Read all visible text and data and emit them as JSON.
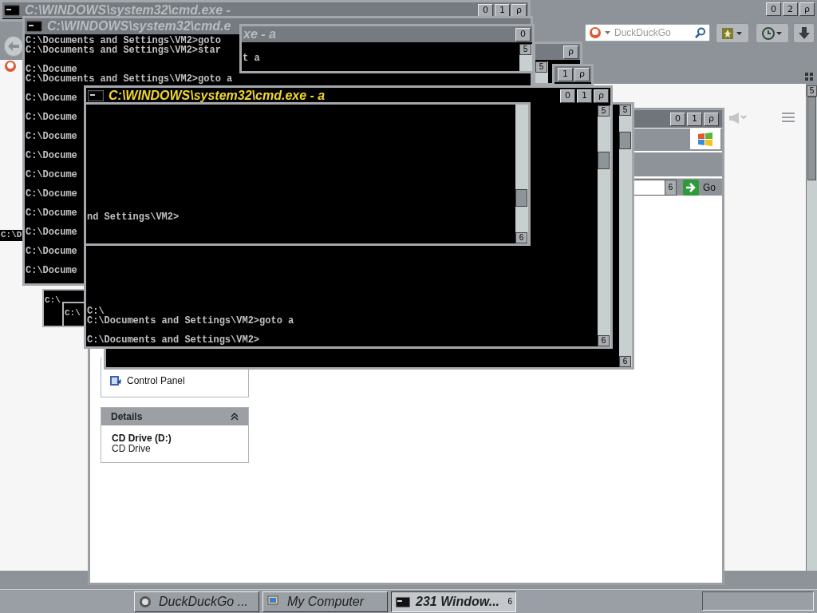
{
  "browser": {
    "title_buttons": [
      "0",
      "2",
      "ρ"
    ],
    "search": {
      "placeholder": "DuckDuckGo"
    },
    "scroll_button": "5"
  },
  "explorer": {
    "title_buttons": [
      "0",
      "1",
      "ρ"
    ],
    "address_button": "6",
    "go_label": "Go",
    "tasks": [
      {
        "label": "Control Panel"
      }
    ],
    "details": {
      "title": "Details",
      "name": "CD Drive (D:)",
      "type": "CD Drive"
    }
  },
  "consoles": [
    {
      "title": "C:\\WINDOWS\\system32\\cmd.exe -",
      "active": false,
      "buttons": [
        "0",
        "1",
        "ρ"
      ]
    },
    {
      "title": "C:\\WINDOWS\\system32\\cmd.e",
      "active": false,
      "blocks": [
        [
          "C:\\Documents and Settings\\VM2>goto",
          "C:\\Documents and Settings\\VM2>star"
        ],
        [
          "C:\\Docume",
          "C:\\Documents and Settings\\VM2>goto a"
        ],
        [
          "C:\\Docume"
        ],
        [
          "C:\\Docume"
        ],
        [
          "C:\\Docume"
        ],
        [
          "C:\\Docume"
        ],
        [
          "C:\\Docume"
        ],
        [
          "C:\\Docume"
        ],
        [
          "C:\\Docume"
        ],
        [
          "C:\\Docume"
        ],
        [
          "C:\\Docume"
        ],
        [
          "C:\\Docume"
        ]
      ]
    },
    {
      "title": "xe - a",
      "active": false,
      "buttons": [
        "0"
      ],
      "blocks": [
        [
          "t a"
        ]
      ],
      "scroll_buttons": [
        "5"
      ]
    },
    {
      "buttons": [
        "ρ"
      ],
      "scroll_buttons": [
        "5"
      ]
    },
    {
      "buttons": [
        "1",
        "ρ"
      ]
    },
    {
      "scroll_buttons": [
        "5",
        "6"
      ]
    },
    {
      "title": "C:\\WINDOWS\\system32\\cmd.exe - a",
      "active": true,
      "buttons": [
        "0",
        "1",
        "ρ"
      ],
      "blocks": [
        [
          "C:\\",
          "C:\\Documents and Settings\\VM2>goto a"
        ],
        [
          "C:\\Documents and Settings\\VM2>"
        ]
      ],
      "scroll_buttons": [
        "5",
        "6"
      ]
    },
    {
      "blocks": [
        [
          "nd Settings\\VM2>"
        ]
      ],
      "scroll_buttons": [
        "6"
      ]
    }
  ],
  "fragments": [
    {
      "text": "C:\\D"
    },
    {
      "text": "C:\\"
    },
    {
      "text": "C:\\"
    }
  ],
  "taskbar": {
    "items": [
      {
        "kind": "browser",
        "label": "DuckDuckGo ...",
        "selected": false
      },
      {
        "kind": "computer",
        "label": "My Computer",
        "selected": false
      },
      {
        "kind": "console",
        "label": "231 Window...",
        "badge": "6",
        "selected": true
      }
    ]
  }
}
